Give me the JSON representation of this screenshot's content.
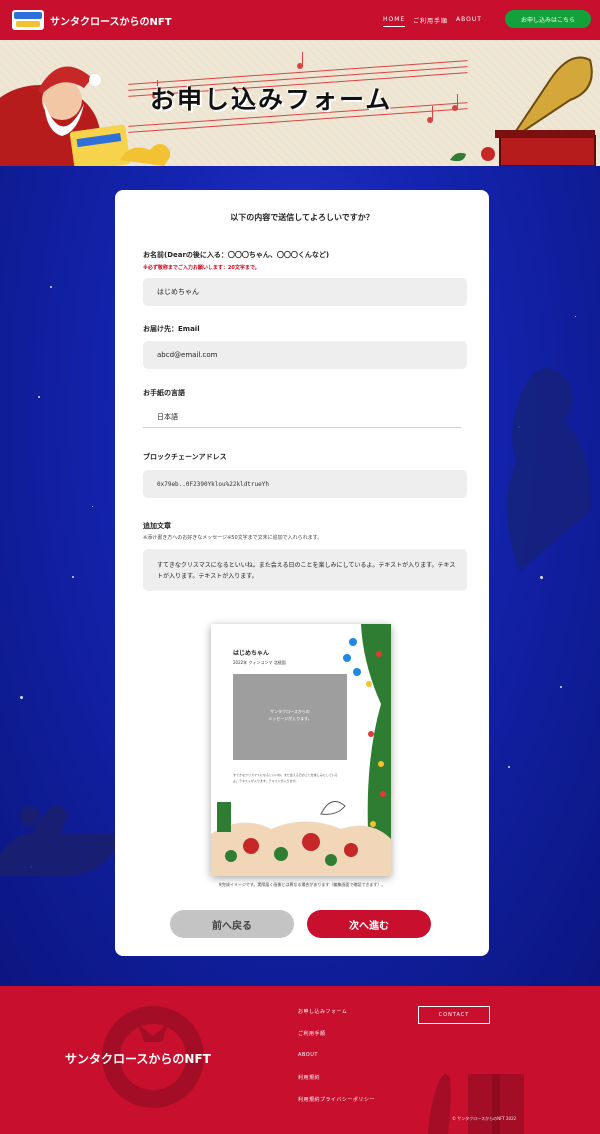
{
  "header": {
    "site_title": "サンタクロースからのNFT",
    "nav": [
      "HOME",
      "ご利用手順",
      "ABOUT"
    ],
    "cta_label": "お申し込みはこちら"
  },
  "hero": {
    "title": "お申し込みフォーム"
  },
  "form": {
    "heading": "以下の内容で送信してよろしいですか？",
    "name": {
      "label": "お名前(Dearの後に入る：〇〇〇ちゃん、〇〇〇くんなど)",
      "note": "※必ず敬称までご入力お願いします：20文字まで。",
      "value": "はじめちゃん"
    },
    "email": {
      "label": "お届け先：Email",
      "value": "abcd@email.com"
    },
    "language": {
      "label": "お手紙の言語",
      "value": "日本語"
    },
    "blockchain": {
      "label": "ブロックチェーンアドレス",
      "value": "0x79eb..0F2390Yklou%22kldtrueYh"
    },
    "message": {
      "label": "追加文章",
      "note": "※添け書き方へのお好きなメッセージ※50文字まで文末に追加で入れられます。",
      "value": "すてきなクリスマスになるといいね。また会える日のことを楽しみにしているよ。テキストが入ります。テキストが入ります。テキストが入ります。"
    }
  },
  "preview": {
    "name": "はじめちゃん",
    "subtitle": "2022年 クィンコンマ 北極園",
    "box_text": "サンタクロースからの\nメッセージが入ります。",
    "small_text": "すてきなクリスマスになるといいね。また会える日のことを楽しみにしているよ。テキストが入ります。テキストが入ります。",
    "caption": "※完成イメージです。実際届く画像とは異なる場合があります（編集画面で確認できます）。"
  },
  "buttons": {
    "back": "前へ戻る",
    "next": "次へ進む"
  },
  "footer": {
    "title": "サンタクロースからのNFT",
    "links": [
      "お申し込みフォーム",
      "ご利用手順",
      "ABOUT",
      "利用規約",
      "利用規約プライバシーポリシー"
    ],
    "contact": "CONTACT",
    "copyright": "© サンタクロースからのNFT 2022"
  },
  "colors": {
    "brand_red": "#c8102e",
    "cta_green": "#12a13a",
    "night_blue": "#1424b0"
  }
}
